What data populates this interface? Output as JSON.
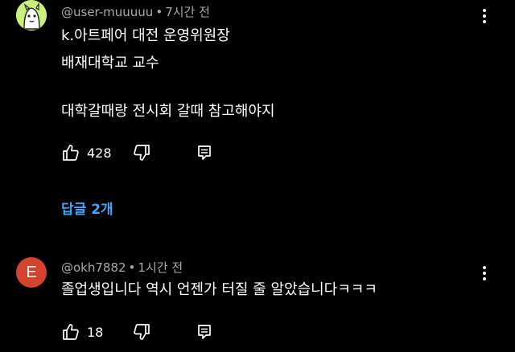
{
  "comments": [
    {
      "username": "@user-muuuuu",
      "time": "7시간 전",
      "lines": [
        "k.아트페어 대전 운영위원장",
        "배재대학교 교수",
        "",
        "대학갈때랑 전시회 갈때 참고해야지"
      ],
      "likes": "428",
      "replies_label": "답글 2개"
    },
    {
      "avatar_letter": "E",
      "username": "@okh7882",
      "time": "1시간 전",
      "lines": [
        "졸업생입니다 역시 언젠가 터질 줄 알았습니다ㅋㅋㅋ"
      ],
      "likes": "18"
    }
  ],
  "separator": "•",
  "colors": {
    "background": "#000000",
    "meta_text": "#aaaaaa",
    "reply_link": "#3ea6ff",
    "avatar_1": "#c8f07a",
    "avatar_2": "#d4432e"
  },
  "icons": [
    "more-vert-icon",
    "thumb-up-icon",
    "thumb-down-icon",
    "reply-icon"
  ]
}
